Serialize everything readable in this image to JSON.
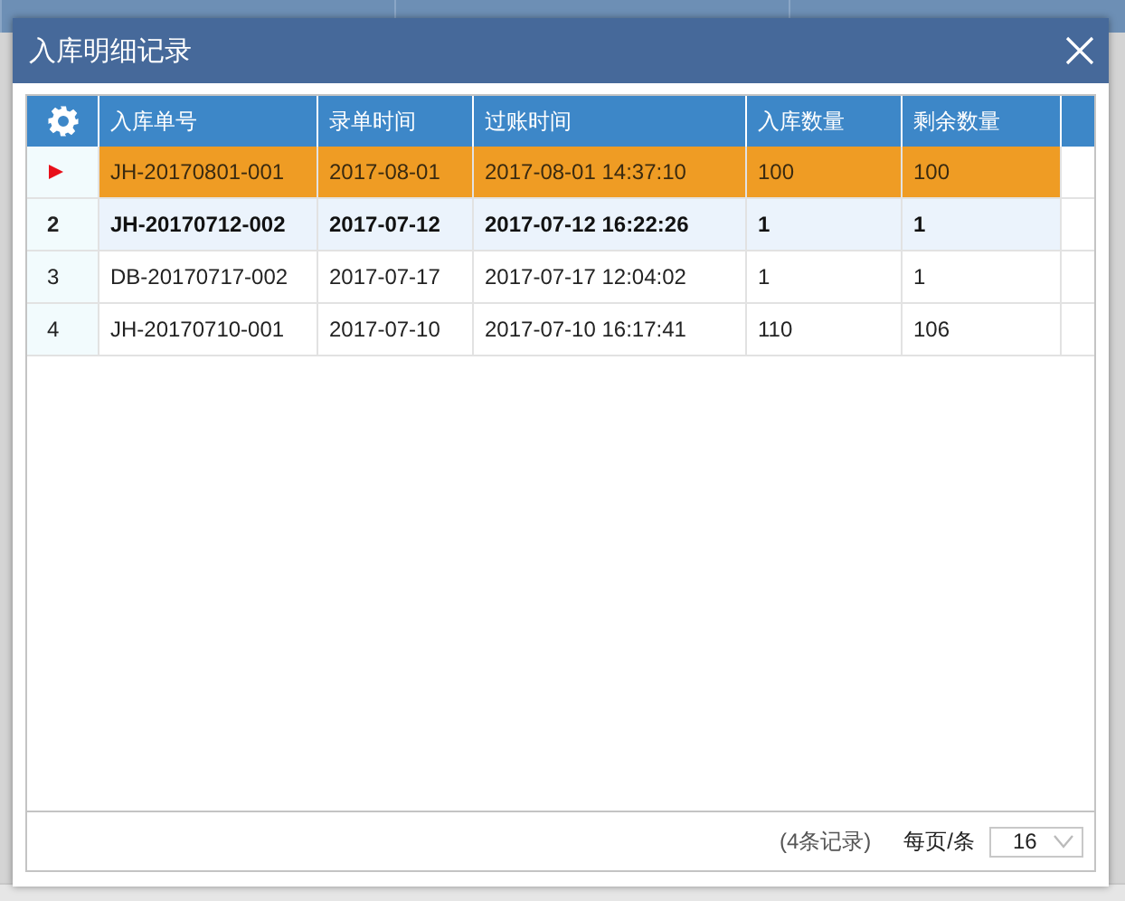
{
  "window": {
    "title": "入库明细记录"
  },
  "table": {
    "columns": [
      "入库单号",
      "录单时间",
      "过账时间",
      "入库数量",
      "剩余数量"
    ],
    "rows": [
      {
        "selected": true,
        "highlighted": false,
        "cells": [
          "JH-20170801-001",
          "2017-08-01",
          "2017-08-01 14:37:10",
          "100",
          "100"
        ]
      },
      {
        "row_number": "2",
        "selected": false,
        "highlighted": true,
        "cells": [
          "JH-20170712-002",
          "2017-07-12",
          "2017-07-12 16:22:26",
          "1",
          "1"
        ]
      },
      {
        "row_number": "3",
        "selected": false,
        "highlighted": false,
        "cells": [
          "DB-20170717-002",
          "2017-07-17",
          "2017-07-17 12:04:02",
          "1",
          "1"
        ]
      },
      {
        "row_number": "4",
        "selected": false,
        "highlighted": false,
        "cells": [
          "JH-20170710-001",
          "2017-07-10",
          "2017-07-10 16:17:41",
          "110",
          "106"
        ]
      }
    ]
  },
  "footer": {
    "record_count": "(4条记录)",
    "page_size_label": "每页/条",
    "page_size": "16"
  }
}
